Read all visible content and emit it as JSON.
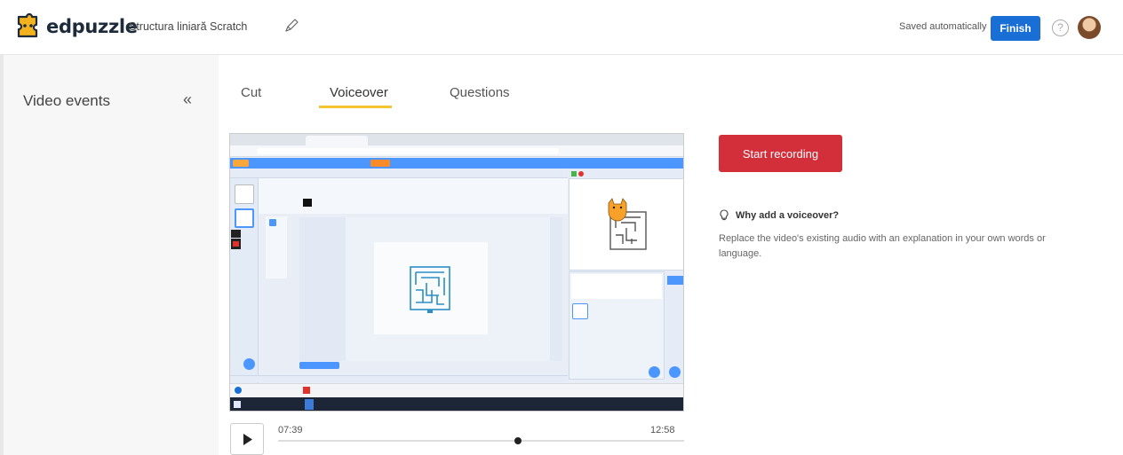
{
  "app": {
    "logo_text": "edpuzzle",
    "project_title": "Structura liniară Scratch",
    "saved_status": "Saved automatically",
    "finish_label": "Finish",
    "help_symbol": "?"
  },
  "sidebar": {
    "title": "Video events",
    "collapse_symbol": "«"
  },
  "tabs": [
    {
      "label": "Cut",
      "active": false
    },
    {
      "label": "Voiceover",
      "active": true
    },
    {
      "label": "Questions",
      "active": false
    }
  ],
  "player": {
    "current_time": "07:39",
    "total_time": "12:58",
    "progress_fraction": 0.59
  },
  "voiceover": {
    "record_label": "Start recording",
    "why_title": "Why add a voiceover?",
    "why_desc": "Replace the video's existing audio with an explanation in your own words or language."
  },
  "colors": {
    "finish_blue": "#1a6fd6",
    "record_red": "#d32f3a",
    "tab_accent": "#f5c431",
    "scratch_blue": "#4c97ff"
  },
  "icons": {
    "logo": "edpuzzle-puzzle-icon",
    "edit": "pencil-icon",
    "help": "help-circle-icon",
    "collapse": "double-chevron-left-icon",
    "play": "play-icon",
    "tip": "lightbulb-icon"
  }
}
